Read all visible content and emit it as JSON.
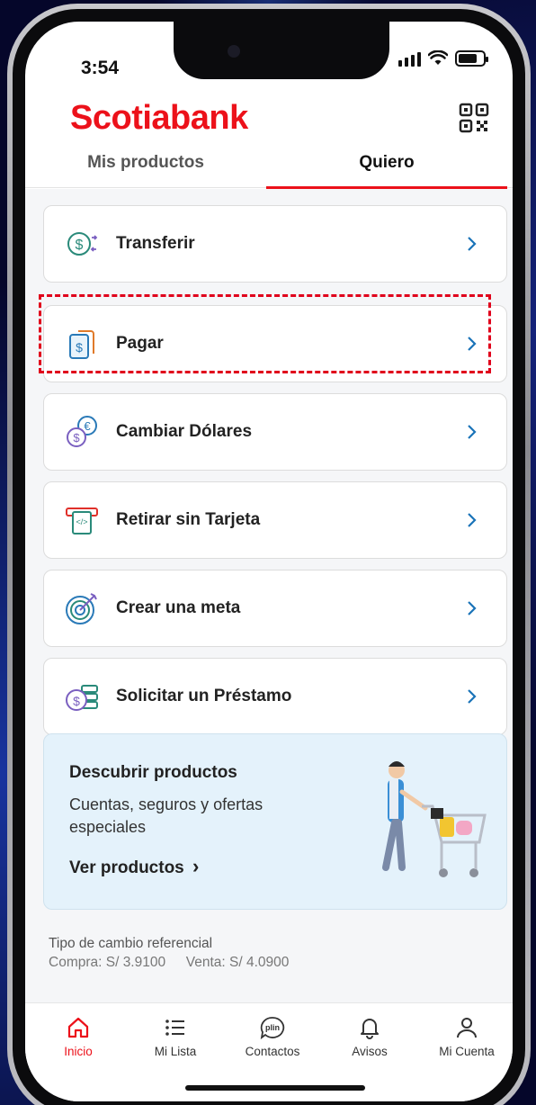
{
  "status": {
    "time": "3:54"
  },
  "header": {
    "logo": "Scotiabank",
    "qr_icon": "qr-code-icon"
  },
  "tabs": [
    {
      "label": "Mis productos",
      "active": false
    },
    {
      "label": "Quiero",
      "active": true
    }
  ],
  "actions": [
    {
      "label": "Transferir",
      "icon": "transfer-icon"
    },
    {
      "label": "Pagar",
      "icon": "pay-document-icon",
      "highlighted": true
    },
    {
      "label": "Cambiar Dólares",
      "icon": "currency-exchange-icon"
    },
    {
      "label": "Retirar sin Tarjeta",
      "icon": "atm-cardless-icon"
    },
    {
      "label": "Crear una meta",
      "icon": "target-goal-icon"
    },
    {
      "label": "Solicitar un Préstamo",
      "icon": "loan-icon"
    }
  ],
  "promo": {
    "title": "Descubrir productos",
    "description": "Cuentas, seguros y ofertas especiales",
    "link": "Ver productos",
    "chevron": "›"
  },
  "rates": {
    "title": "Tipo de cambio referencial",
    "buy": "Compra: S/ 3.9100",
    "sell": "Venta: S/ 4.0900"
  },
  "bottom_nav": [
    {
      "label": "Inicio",
      "icon": "home-icon",
      "active": true
    },
    {
      "label": "Mi Lista",
      "icon": "list-icon",
      "active": false
    },
    {
      "label": "Contactos",
      "icon": "plin-icon",
      "icon_text": "plin",
      "active": false
    },
    {
      "label": "Avisos",
      "icon": "bell-icon",
      "active": false
    },
    {
      "label": "Mi Cuenta",
      "icon": "user-icon",
      "active": false
    }
  ],
  "colors": {
    "brand_red": "#ec111a",
    "chevron_blue": "#1a73b8",
    "promo_bg": "#e4f2fb",
    "highlight_dash": "#e0001b"
  }
}
